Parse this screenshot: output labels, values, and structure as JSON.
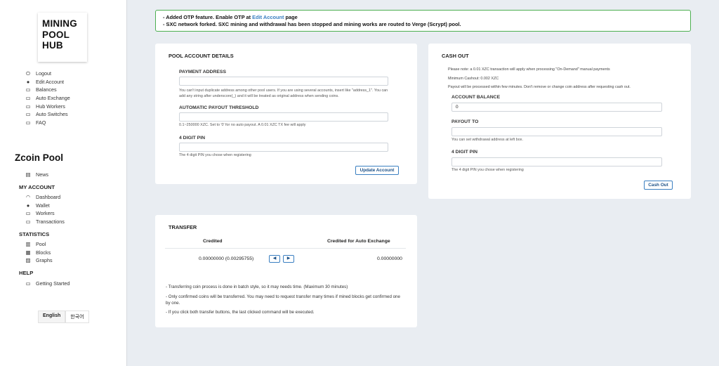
{
  "logo": {
    "lines": [
      "MINING",
      "POOL",
      "HUB"
    ]
  },
  "top_menu": [
    {
      "icon": "power-icon",
      "glyph": "⏻",
      "label": "Logout"
    },
    {
      "icon": "user-icon",
      "glyph": "●",
      "label": "Edit Account"
    },
    {
      "icon": "monitor-icon",
      "glyph": "▭",
      "label": "Balances"
    },
    {
      "icon": "monitor-icon",
      "glyph": "▭",
      "label": "Auto Exchange"
    },
    {
      "icon": "monitor-icon",
      "glyph": "▭",
      "label": "Hub Workers"
    },
    {
      "icon": "monitor-icon",
      "glyph": "▭",
      "label": "Auto Switches"
    },
    {
      "icon": "monitor-icon",
      "glyph": "▭",
      "label": "FAQ"
    }
  ],
  "pool_title": "Zcoin Pool",
  "news": {
    "icon": "news-icon",
    "glyph": "▤",
    "label": "News"
  },
  "my_account": {
    "heading": "MY ACCOUNT",
    "items": [
      {
        "icon": "dashboard-icon",
        "glyph": "◠",
        "label": "Dashboard"
      },
      {
        "icon": "user-icon",
        "glyph": "●",
        "label": "Wallet"
      },
      {
        "icon": "monitor-icon",
        "glyph": "▭",
        "label": "Workers"
      },
      {
        "icon": "monitor-icon",
        "glyph": "▭",
        "label": "Transactions"
      }
    ]
  },
  "statistics": {
    "heading": "STATISTICS",
    "items": [
      {
        "icon": "bar-chart-icon",
        "glyph": "▥",
        "label": "Pool"
      },
      {
        "icon": "grid-icon",
        "glyph": "▦",
        "label": "Blocks"
      },
      {
        "icon": "graph-icon",
        "glyph": "▨",
        "label": "Graphs"
      }
    ]
  },
  "help": {
    "heading": "HELP",
    "items": [
      {
        "icon": "monitor-icon",
        "glyph": "▭",
        "label": "Getting Started"
      }
    ]
  },
  "languages": [
    "English",
    "한국어"
  ],
  "notice": {
    "line1_prefix": "- Added OTP feature. Enable OTP at ",
    "line1_link": "Edit Account",
    "line1_suffix": " page",
    "line2": "- SXC network forked. SXC mining and withdrawal has been stopped and mining works are routed to Verge (Scrypt) pool."
  },
  "pool_account": {
    "title": "POOL ACCOUNT DETAILS",
    "payment_label": "PAYMENT ADDRESS",
    "payment_value": "",
    "payment_help": "You can't input duplicate address among other pool users. If you are using several accounts, insert like \"address_1\". You can add any string after underscore(_) and it will be treated as original address when sending coins.",
    "threshold_label": "AUTOMATIC PAYOUT THRESHOLD",
    "threshold_value": "",
    "threshold_help": "0.1~250000 XZC. Set to '0' for no auto payout. A 0.01 XZC TX fee will apply",
    "pin_label": "4 DIGIT PIN",
    "pin_value": "",
    "pin_help": "The 4 digit PIN you chose when registering",
    "button": "Update Account"
  },
  "cash_out": {
    "title": "CASH OUT",
    "note1": "Please note: a 0.01 XZC transaction will apply when processing \"On-Demand\" manual payments",
    "note2": "Minimum Cashout: 0.002 XZC",
    "note3": "Payout will be processed within few minutes. Don't remove or change coin address after requesting cash out.",
    "balance_label": "ACCOUNT BALANCE",
    "balance_value": "0",
    "payout_label": "PAYOUT TO",
    "payout_value": "",
    "payout_help": "You can set withdrawal address at left box.",
    "pin_label": "4 DIGIT PIN",
    "pin_value": "",
    "pin_help": "The 4 digit PIN you chose when registering",
    "button": "Cash Out"
  },
  "transfer": {
    "title": "TRANSFER",
    "col_credited": "Credited",
    "col_auto": "Credited for Auto Exchange",
    "credited_value": "0.00000000 (0.00295755)",
    "auto_value": "0.00000000",
    "left_arrow": "◀",
    "right_arrow": "▶",
    "notes": [
      "- Transferring coin process is done in batch style, so it may needs time. (Maximum 30 minutes)",
      "- Only confirmed coins will be transferred. You may need to request transfer many times if mined blocks get confirmed one by one.",
      "- If you click both transfer buttons, the last clicked command will be executed."
    ]
  }
}
